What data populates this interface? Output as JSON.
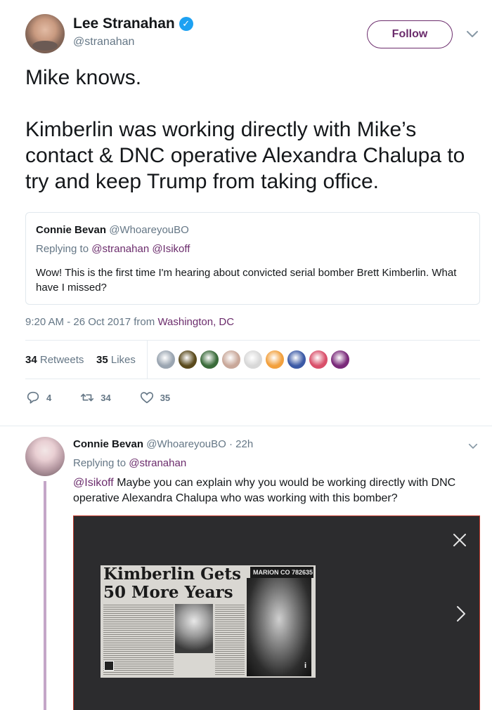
{
  "main_tweet": {
    "author_name": "Lee Stranahan",
    "author_handle": "@stranahan",
    "follow_label": "Follow",
    "text_paragraphs": [
      "Mike knows.",
      "Kimberlin was working directly with Mike’s contact & DNC operative Alexandra Chalupa to try and keep Trump from taking office."
    ],
    "quote": {
      "name": "Connie Bevan",
      "handle": "@WhoareyouBO",
      "replying_prefix": "Replying to",
      "replying_to": "@stranahan @Isikoff",
      "text": "Wow! This is the first time I'm hearing about convicted serial bomber Brett Kimberlin. What have I missed?"
    },
    "timestamp": "9:20 AM - 26 Oct 2017 from",
    "location": "Washington, DC",
    "retweets_count": "34",
    "retweets_label": "Retweets",
    "likes_count": "35",
    "likes_label": "Likes",
    "liker_colors": [
      "#9aa5b1",
      "#5a4a1c",
      "#3a6b3a",
      "#c9a89a",
      "#d8d8d8",
      "#f2a03d",
      "#3c5aa6",
      "#d94f6a",
      "#7a2a7a"
    ],
    "actions": {
      "reply_count": "4",
      "retweet_count": "34",
      "like_count": "35"
    },
    "icons": {
      "verified": "verified-badge-icon",
      "chevron": "chevron-down-icon"
    }
  },
  "reply_tweet": {
    "author_name": "Connie Bevan",
    "author_handle": "@WhoareyouBO",
    "age": "· 22h",
    "replying_prefix": "Replying to",
    "replying_to": "@stranahan",
    "mention": "@Isikoff",
    "text": " Maybe you can explain why you would be working directly with DNC operative Alexandra Chalupa who was working with this bomber?",
    "media": {
      "headline_line1": "Kimberlin Gets",
      "headline_line2": "50 More Years",
      "badge_text": "MARION CO 782635",
      "info_label": "i"
    }
  },
  "colors": {
    "accent": "#6b2c6c",
    "text_primary": "#14171a",
    "text_secondary": "#657786",
    "verified": "#1da1f2",
    "media_border": "#c0392b"
  }
}
